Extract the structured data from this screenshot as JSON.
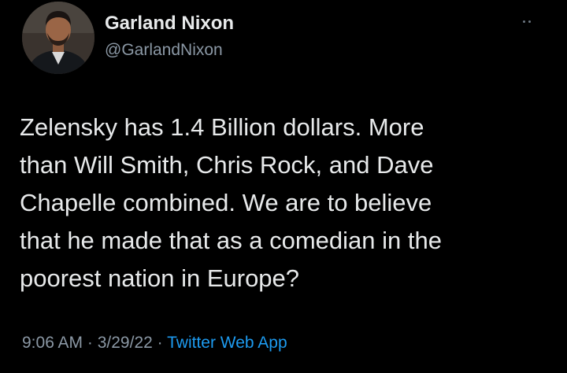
{
  "tweet": {
    "author": {
      "display_name": "Garland Nixon",
      "handle": "@GarlandNixon"
    },
    "text_lines": [
      "Zelensky has 1.4 Billion dollars. More",
      "than Will Smith, Chris Rock, and Dave",
      "Chapelle combined. We are to believe",
      "that he made that as a comedian in the",
      "poorest nation in Europe?"
    ],
    "time": "9:06 AM",
    "separator": " · ",
    "date": "3/29/22",
    "source": "Twitter Web App"
  },
  "icons": {
    "more": "more-options-icon",
    "avatar": "profile-avatar"
  },
  "colors": {
    "background": "#000000",
    "primary_text": "#e7e9ea",
    "secondary_text": "#8b98a5",
    "link": "#1d9bf0"
  }
}
